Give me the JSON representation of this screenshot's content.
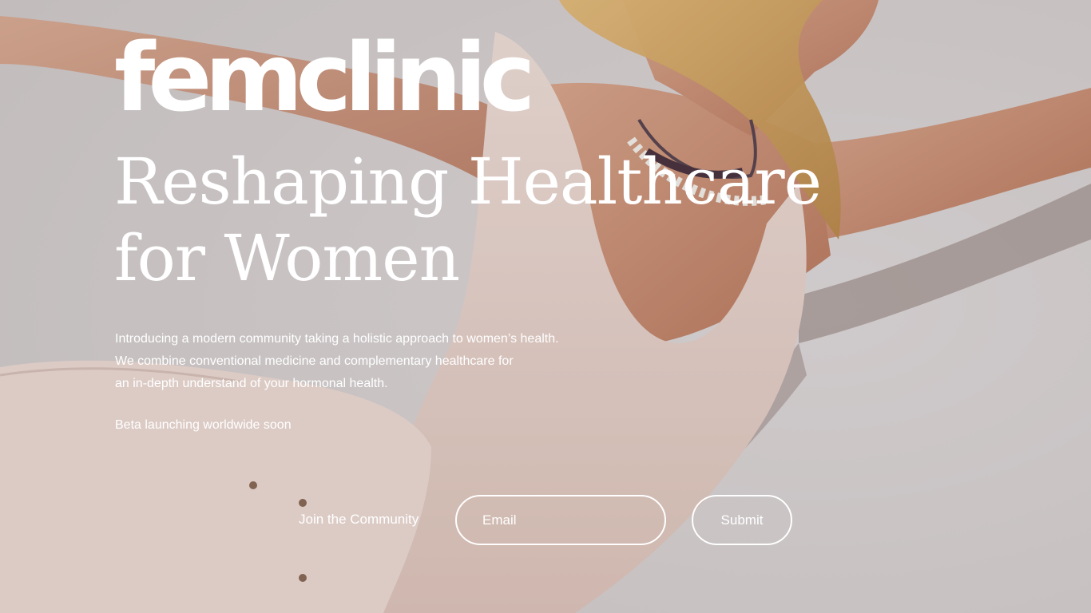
{
  "brand": {
    "logo_text": "femclinic"
  },
  "hero": {
    "headline": "Reshaping Healthcare for Women",
    "intro_lines": [
      "Introducing a modern community taking a holistic approach to women’s health.",
      "We combine conventional medicine and complementary healthcare for",
      "an in-depth understand of your hormonal health."
    ],
    "beta_note": "Beta launching worldwide soon"
  },
  "signup": {
    "label": "Join the Community",
    "email_placeholder": "Email",
    "submit_label": "Submit"
  },
  "colors": {
    "text": "#ffffff",
    "background_wall": "#d9d3d3",
    "skin": "#c98f74",
    "garment": "#e6d3cc"
  }
}
